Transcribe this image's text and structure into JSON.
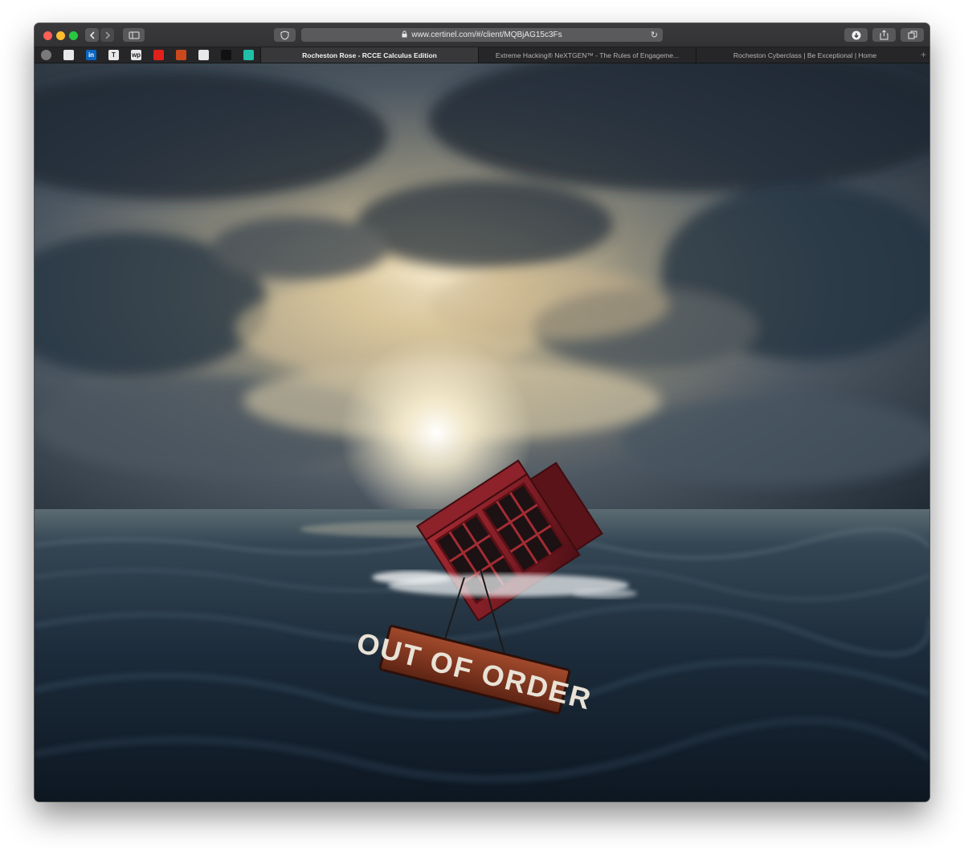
{
  "browser": {
    "url": "www.certinel.com/#/client/MQBjAG15c3Fs",
    "tabs": [
      {
        "label": "Rocheston Rose - RCCE Calculus Edition",
        "active": true
      },
      {
        "label": "Extreme Hacking® NeXTGEN™ - The Rules of Engageme...",
        "active": false
      },
      {
        "label": "Rocheston Cyberclass | Be Exceptional | Home",
        "active": false
      }
    ],
    "bookmarks": [
      {
        "icon": "globe-icon",
        "text": "",
        "color": "#7a7a7a"
      },
      {
        "icon": "bookmark-app-icon",
        "text": "",
        "color": "#e8e8e8"
      },
      {
        "icon": "linkedin-icon",
        "text": "in",
        "color": "#0a66c2"
      },
      {
        "icon": "nyt-icon",
        "text": "T",
        "color": "#e8e8e8"
      },
      {
        "icon": "washington-post-icon",
        "text": "wp",
        "color": "#e8e8e8"
      },
      {
        "icon": "red-square-icon",
        "text": "",
        "color": "#e0201b"
      },
      {
        "icon": "feed-icon",
        "text": "",
        "color": "#c9481d"
      },
      {
        "icon": "camera-icon",
        "text": "",
        "color": "#e8e8e8"
      },
      {
        "icon": "music-icon",
        "text": "",
        "color": "#111111"
      },
      {
        "icon": "app-icon",
        "text": "",
        "color": "#1fbfa8"
      }
    ]
  },
  "page": {
    "sign_text": "OUT OF ORDER",
    "accent_colors": {
      "sky": "#2f3d4a",
      "sun": "#f7e7c2",
      "sea": "#1d2f42",
      "booth": "#8a1f26"
    }
  }
}
